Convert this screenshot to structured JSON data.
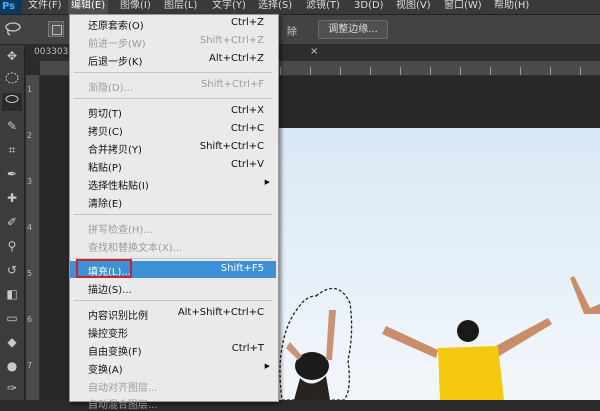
{
  "menubar": {
    "logo": "Ps",
    "items": [
      {
        "label": "文件(F)"
      },
      {
        "label": "编辑(E)"
      },
      {
        "label": "图像(I)"
      },
      {
        "label": "图层(L)"
      },
      {
        "label": "文字(Y)"
      },
      {
        "label": "选择(S)"
      },
      {
        "label": "滤镜(T)"
      },
      {
        "label": "3D(D)"
      },
      {
        "label": "视图(V)"
      },
      {
        "label": "窗口(W)"
      },
      {
        "label": "帮助(H)"
      }
    ]
  },
  "options_bar": {
    "partial_text": "除",
    "refine_edge_button": "调整边缘..."
  },
  "document_tab": {
    "name_partial": "003303",
    "close": "×"
  },
  "ruler_v_labels": [
    "1",
    "2",
    "3",
    "4",
    "5",
    "6",
    "7"
  ],
  "edit_menu": {
    "items": [
      {
        "label": "还原套索(O)",
        "shortcut": "Ctrl+Z",
        "disabled": false
      },
      {
        "label": "前进一步(W)",
        "shortcut": "Shift+Ctrl+Z",
        "disabled": true
      },
      {
        "label": "后退一步(K)",
        "shortcut": "Alt+Ctrl+Z",
        "disabled": false
      },
      {
        "label": "渐隐(D)...",
        "shortcut": "Shift+Ctrl+F",
        "disabled": true
      },
      {
        "label": "剪切(T)",
        "shortcut": "Ctrl+X",
        "disabled": false
      },
      {
        "label": "拷贝(C)",
        "shortcut": "Ctrl+C",
        "disabled": false
      },
      {
        "label": "合并拷贝(Y)",
        "shortcut": "Shift+Ctrl+C",
        "disabled": false
      },
      {
        "label": "粘贴(P)",
        "shortcut": "Ctrl+V",
        "disabled": false
      },
      {
        "label": "选择性粘贴(I)",
        "shortcut": "",
        "disabled": false,
        "submenu": true
      },
      {
        "label": "清除(E)",
        "shortcut": "",
        "disabled": false
      },
      {
        "label": "拼写检查(H)...",
        "shortcut": "",
        "disabled": true
      },
      {
        "label": "查找和替换文本(X)...",
        "shortcut": "",
        "disabled": true
      },
      {
        "label": "填充(L)...",
        "shortcut": "Shift+F5",
        "disabled": false,
        "highlighted": true
      },
      {
        "label": "描边(S)...",
        "shortcut": "",
        "disabled": false
      },
      {
        "label": "内容识别比例",
        "shortcut": "Alt+Shift+Ctrl+C",
        "disabled": false
      },
      {
        "label": "操控变形",
        "shortcut": "",
        "disabled": false
      },
      {
        "label": "自由变换(F)",
        "shortcut": "Ctrl+T",
        "disabled": false
      },
      {
        "label": "变换(A)",
        "shortcut": "",
        "disabled": false,
        "submenu": true
      },
      {
        "label": "自动对齐图层...",
        "shortcut": "",
        "disabled": true
      },
      {
        "label": "自动混合图层...",
        "shortcut": "",
        "disabled": true
      }
    ]
  },
  "colors": {
    "highlight": "#3d8fd8",
    "annotation_box": "#d0202a",
    "shirt": "#f3c80e"
  }
}
